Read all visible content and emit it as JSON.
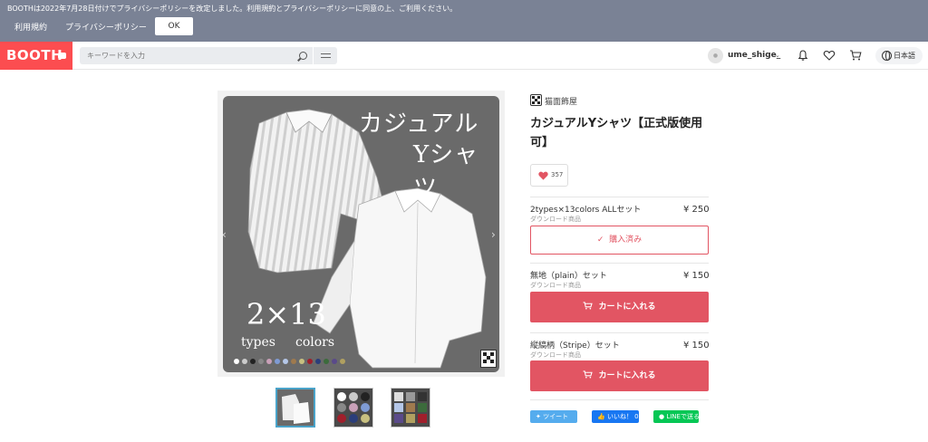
{
  "notice": {
    "text": "BOOTHは2022年7月28日付けでプライバシーポリシーを改定しました。利用規約とプライバシーポリシーに同意の上、ご利用ください。",
    "terms_link": "利用規約",
    "privacy_link": "プライバシーポリシー",
    "ok_label": "OK"
  },
  "header": {
    "logo": "BOOTH",
    "search_placeholder": "キーワードを入力",
    "username": "ume_shige_",
    "language": "日本語"
  },
  "gallery": {
    "image_title_line1": "カジュアル",
    "image_title_line2": "Yシャツ",
    "image_big_text": "2×13",
    "image_types": "types",
    "image_colors": "colors",
    "swatch_colors": [
      "#ffffff",
      "#cccccc",
      "#222222",
      "#888888",
      "#c9a0b8",
      "#7f9bd4",
      "#b5c7e8",
      "#9f7a4e",
      "#c8c080",
      "#a01f2b",
      "#2b3e7a",
      "#3c6b3c",
      "#5a4a8a",
      "#b0a060"
    ]
  },
  "product": {
    "shop_name": "猫面飾屋",
    "title": "カジュアルYシャツ【正式版使用可】",
    "like_count": "357",
    "variants": [
      {
        "name": "2types×13colors ALLセット",
        "type": "ダウンロード商品",
        "price": "¥ 250",
        "button": "購入済み"
      },
      {
        "name": "無地（plain）セット",
        "type": "ダウンロード商品",
        "price": "¥ 150",
        "button": "カートに入れる"
      },
      {
        "name": "縦縞柄（Stripe）セット",
        "type": "ダウンロード商品",
        "price": "¥ 150",
        "button": "カートに入れる"
      }
    ]
  },
  "share": {
    "tweet": "ツイート",
    "facebook": "いいね！ 0",
    "line": "LINEで送る"
  },
  "colors": {
    "brand": "#fc4d50",
    "accent": "#e25563",
    "notice_bg": "#7a8295"
  }
}
